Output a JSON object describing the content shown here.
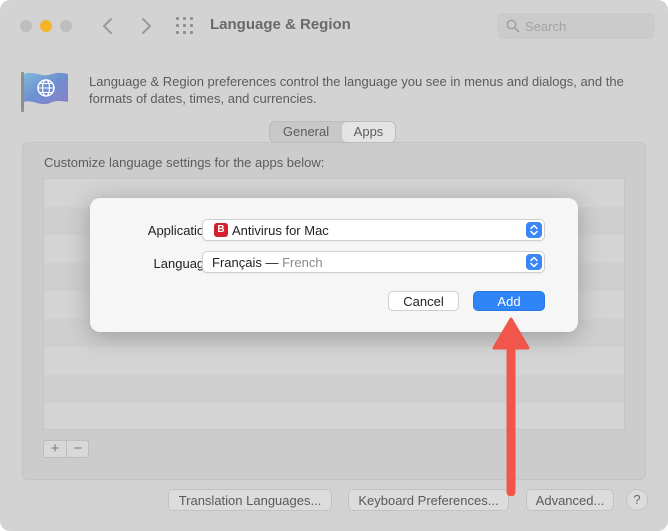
{
  "window": {
    "title": "Language & Region",
    "search_placeholder": "Search",
    "description": "Language & Region preferences control the language you see in menus and dialogs, and the formats of dates, times, and currencies."
  },
  "tabs": [
    {
      "label": "General",
      "selected": false
    },
    {
      "label": "Apps",
      "selected": true
    }
  ],
  "apps_panel": {
    "instruction": "Customize language settings for the apps below:",
    "add_symbol": "+",
    "remove_symbol": "−"
  },
  "bottom_buttons": {
    "translation": "Translation Languages...",
    "keyboard": "Keyboard Preferences...",
    "advanced": "Advanced...",
    "help": "?"
  },
  "dialog": {
    "application_label": "Application:",
    "application_value": "Antivirus for Mac",
    "application_icon_letter": "B",
    "language_label": "Language:",
    "language_value": "Français —",
    "language_sub": "French",
    "cancel_label": "Cancel",
    "add_label": "Add"
  },
  "colors": {
    "accent": "#2f84f7",
    "minimize": "#f3b42a",
    "annotation_arrow": "#f0564a",
    "app_icon": "#d2202f"
  },
  "icons": {
    "back": "chevron-left-icon",
    "forward": "chevron-right-icon",
    "grid": "grid-icon",
    "search": "search-icon",
    "flag": "flag-globe-icon",
    "stepper": "updown-chevron-icon"
  }
}
